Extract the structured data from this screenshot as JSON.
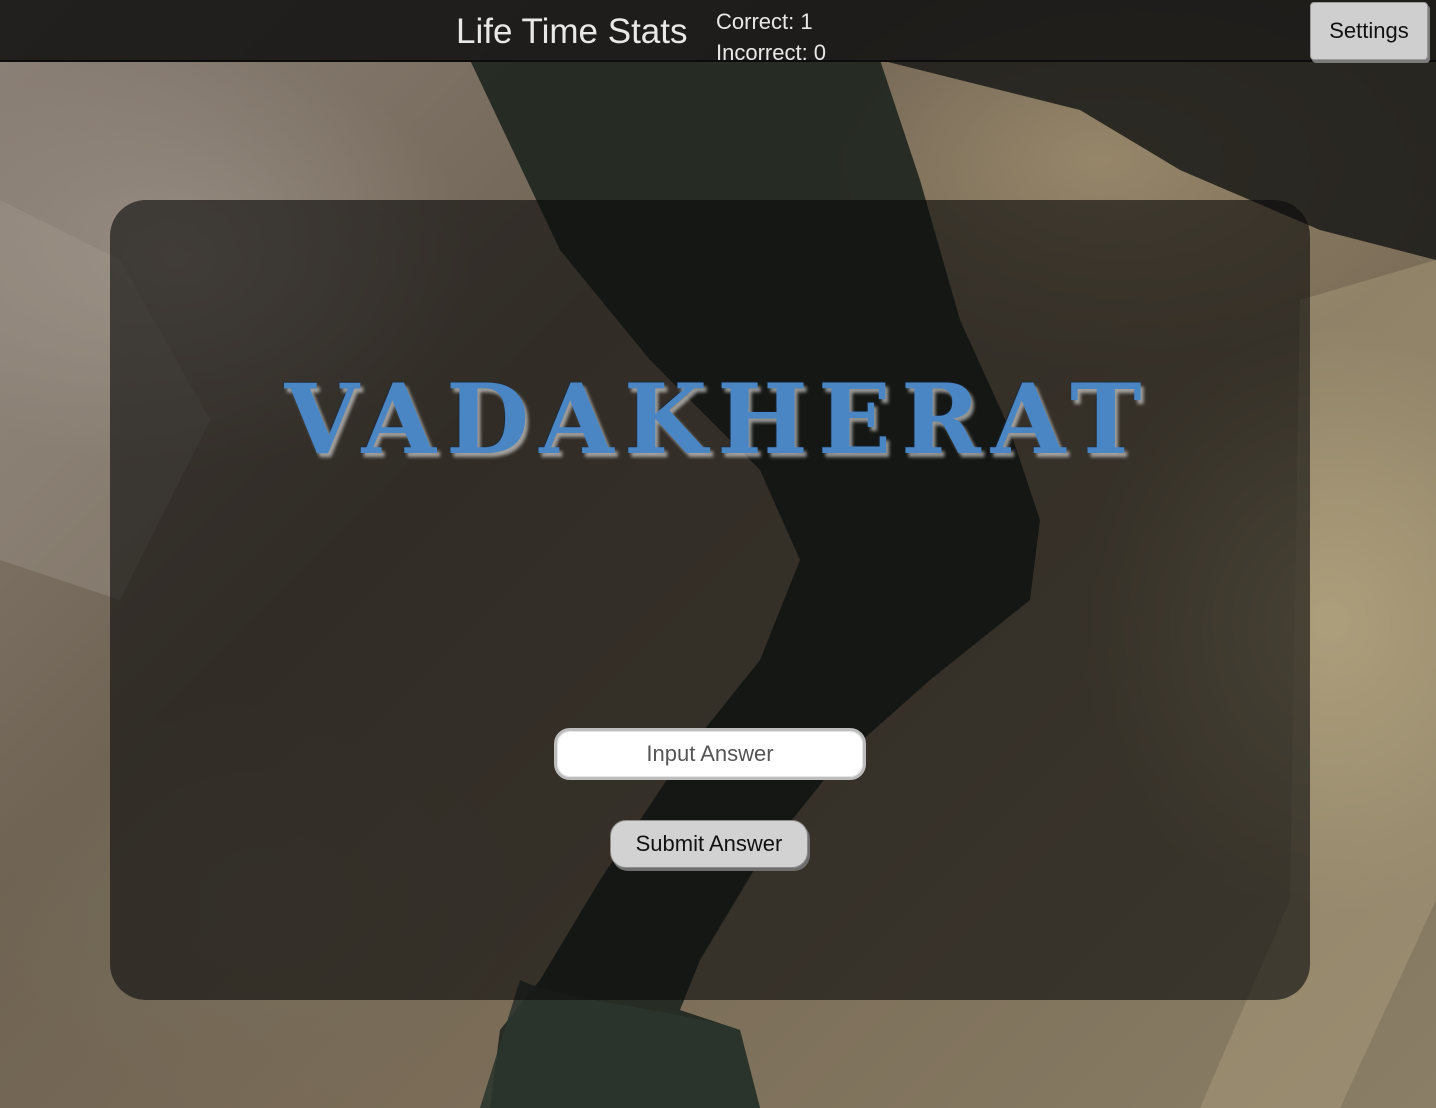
{
  "top_bar": {
    "stats_title": "Life Time Stats",
    "correct_label": "Correct: 1",
    "incorrect_label": "Incorrect: 0",
    "settings_label": "Settings"
  },
  "game": {
    "title": "VADAKHERAT",
    "answer_placeholder": "Input Answer",
    "answer_value": "",
    "submit_label": "Submit Answer"
  },
  "colors": {
    "title": "#4a86c4",
    "top_bar": "#121212",
    "card": "#0c0c0c"
  }
}
